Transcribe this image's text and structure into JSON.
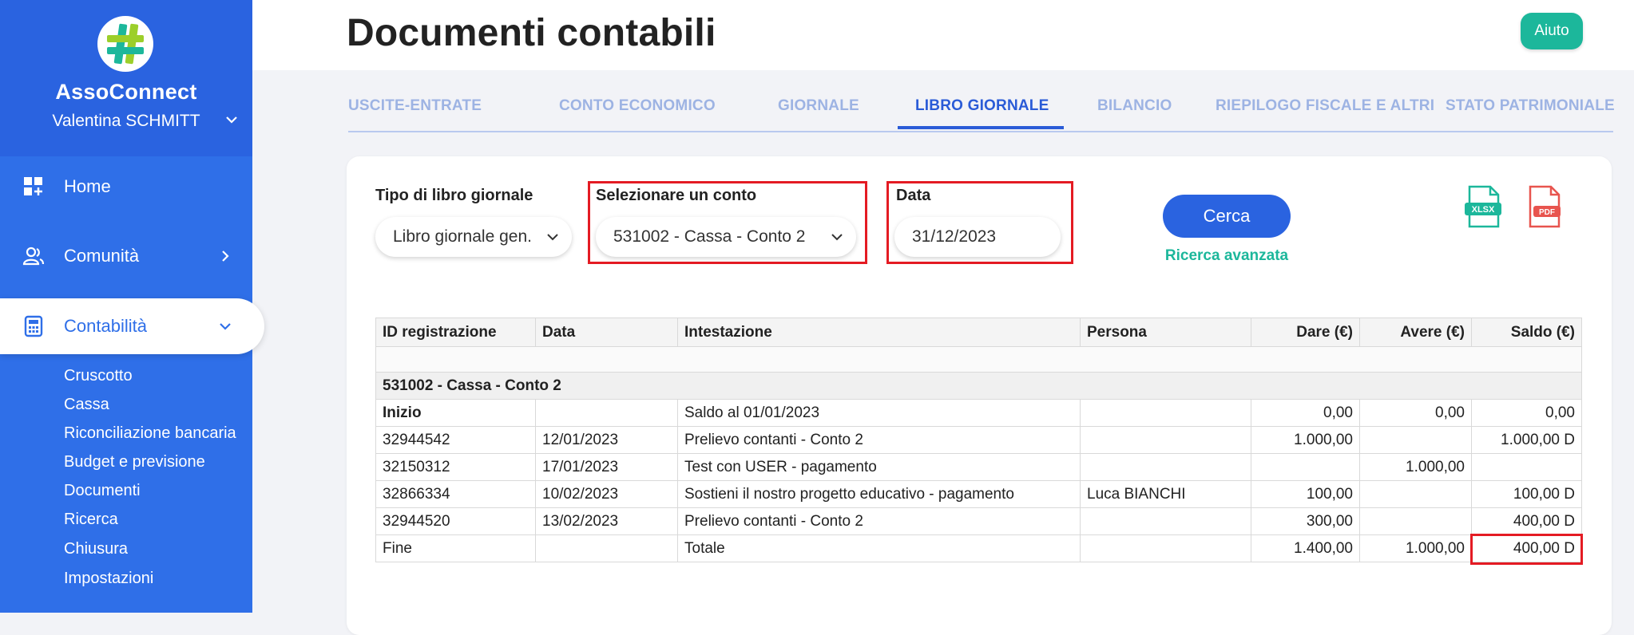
{
  "sidebar": {
    "brand": "AssoConnect",
    "user": "Valentina SCHMITT",
    "nav": [
      {
        "label": "Home"
      },
      {
        "label": "Comunità"
      },
      {
        "label": "Contabilità"
      }
    ],
    "sub_items": [
      "Cruscotto",
      "Cassa",
      "Riconciliazione bancaria",
      "Budget e previsione",
      "Documenti",
      "Ricerca",
      "Chiusura",
      "Impostazioni"
    ]
  },
  "header": {
    "title": "Documenti contabili",
    "help_label": "Aiuto"
  },
  "tabs": [
    "USCITE-ENTRATE",
    "CONTO ECONOMICO",
    "GIORNALE",
    "LIBRO GIORNALE",
    "BILANCIO",
    "RIEPILOGO FISCALE E ALTRI",
    "STATO PATRIMONIALE"
  ],
  "active_tab": "LIBRO GIORNALE",
  "filters": {
    "type_label": "Tipo di libro giornale",
    "type_value": "Libro giornale gen.",
    "account_label": "Selezionare un conto",
    "account_value": "531002 - Cassa - Conto 2",
    "date_label": "Data",
    "date_value": "31/12/2023",
    "search_label": "Cerca",
    "advanced_label": "Ricerca avanzata",
    "xlsx_label": "XLSX",
    "pdf_label": "PDF"
  },
  "colors": {
    "primary": "#2f6fe8",
    "accent": "#1cb79b",
    "highlight": "#e41b23"
  },
  "table": {
    "headers": [
      "ID registrazione",
      "Data",
      "Intestazione",
      "Persona",
      "Dare (€)",
      "Avere (€)",
      "Saldo (€)"
    ],
    "group": "531002 - Cassa - Conto 2",
    "rows": [
      [
        "Inizio",
        "",
        "Saldo al 01/01/2023",
        "",
        "0,00",
        "0,00",
        "0,00"
      ],
      [
        "32944542",
        "12/01/2023",
        "Prelievo contanti - Conto 2",
        "",
        "1.000,00",
        "",
        "1.000,00 D"
      ],
      [
        "32150312",
        "17/01/2023",
        "Test con USER - pagamento",
        "",
        "",
        "1.000,00",
        ""
      ],
      [
        "32866334",
        "10/02/2023",
        "Sostieni il nostro progetto educativo - pagamento",
        "Luca BIANCHI",
        "100,00",
        "",
        "100,00 D"
      ],
      [
        "32944520",
        "13/02/2023",
        "Prelievo contanti - Conto 2",
        "",
        "300,00",
        "",
        "400,00 D"
      ],
      [
        "Fine",
        "",
        "Totale",
        "",
        "1.400,00",
        "1.000,00",
        "400,00 D"
      ]
    ]
  }
}
